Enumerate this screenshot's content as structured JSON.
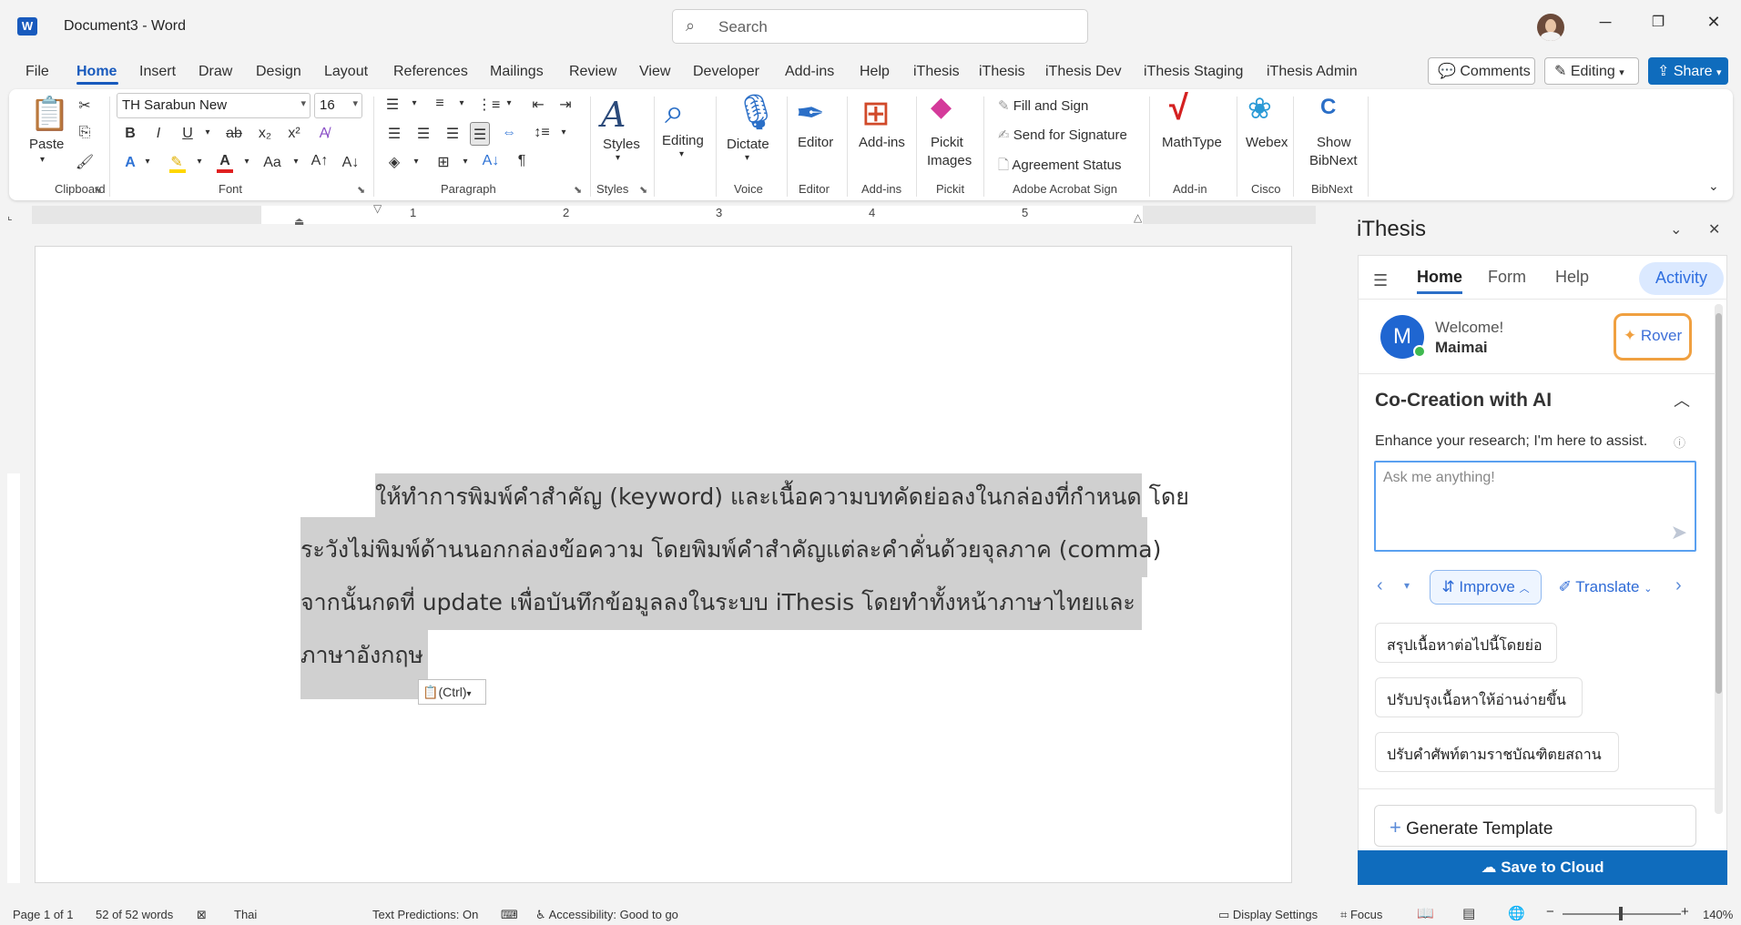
{
  "window": {
    "app_title": "Document3  -  Word",
    "search_placeholder": "Search"
  },
  "menu": [
    "File",
    "Home",
    "Insert",
    "Draw",
    "Design",
    "Layout",
    "References",
    "Mailings",
    "Review",
    "View",
    "Developer",
    "Add-ins",
    "Help",
    "iThesis",
    "iThesis",
    "iThesis Dev",
    "iThesis Staging",
    "iThesis Admin"
  ],
  "top_buttons": {
    "comments": "Comments",
    "editing": "Editing",
    "share": "Share"
  },
  "ribbon": {
    "paste": "Paste",
    "font_name": "TH Sarabun New",
    "font_size": "16",
    "groups": {
      "clipboard": "Clipboard",
      "font": "Font",
      "paragraph": "Paragraph",
      "styles": "Styles",
      "voice": "Voice",
      "editor": "Editor",
      "addins": "Add-ins",
      "pickit": "Pickit",
      "adobe": "Adobe Acrobat Sign",
      "addin": "Add-in",
      "cisco": "Cisco",
      "bibnext": "BibNext"
    },
    "styles": "Styles",
    "editing": "Editing",
    "dictate": "Dictate",
    "editor": "Editor",
    "addins": "Add-ins",
    "pickit": "Pickit",
    "pickit2": "Images",
    "fill_sign": "Fill and Sign",
    "send_sig": "Send for Signature",
    "agreement": "Agreement Status",
    "mathtype": "MathType",
    "webex": "Webex",
    "show": "Show",
    "bibnext": "BibNext"
  },
  "ruler_numbers": [
    "1",
    "2",
    "3",
    "4",
    "5"
  ],
  "document": {
    "line1": "ให้ทำการพิมพ์คำสำคัญ  (keyword)  และเนื้อความบทคัดย่อลงในกล่องที่กำหนด  โดย",
    "line2": "ระวังไม่พิมพ์ด้านนอกกล่องข้อความ     โดยพิมพ์คำสำคัญแต่ละคำคั่นด้วยจุลภาค     (comma)",
    "line3": "จากนั้นกดที่    update    เพื่อบันทึกข้อมูลลงในระบบ    iThesis    โดยทำทั้งหน้าภาษาไทยและ",
    "line4": "ภาษาอังกฤษ",
    "paste_options": "(Ctrl)"
  },
  "pane": {
    "title": "iThesis",
    "tabs": [
      "Home",
      "Form",
      "Help",
      "Activity"
    ],
    "welcome": "Welcome!",
    "user": "Maimai",
    "avatar_letter": "M",
    "rover": "Rover",
    "section": "Co-Creation with AI",
    "enhance": "Enhance your research; I'm here to assist.",
    "ask_placeholder": "Ask me anything!",
    "improve": "Improve",
    "translate": "Translate",
    "suggestions": [
      "สรุปเนื้อหาต่อไปนี้โดยย่อ",
      "ปรับปรุงเนื้อหาให้อ่านง่ายขึ้น",
      "ปรับคำศัพท์ตามราชบัณฑิตยสถาน"
    ],
    "generate": "Generate Template",
    "save": "Save to Cloud"
  },
  "status": {
    "page": "Page 1 of 1",
    "words": "52 of 52 words",
    "lang": "Thai",
    "predictions": "Text Predictions: On",
    "accessibility": "Accessibility: Good to go",
    "display": "Display Settings",
    "focus": "Focus",
    "zoom": "140%"
  }
}
